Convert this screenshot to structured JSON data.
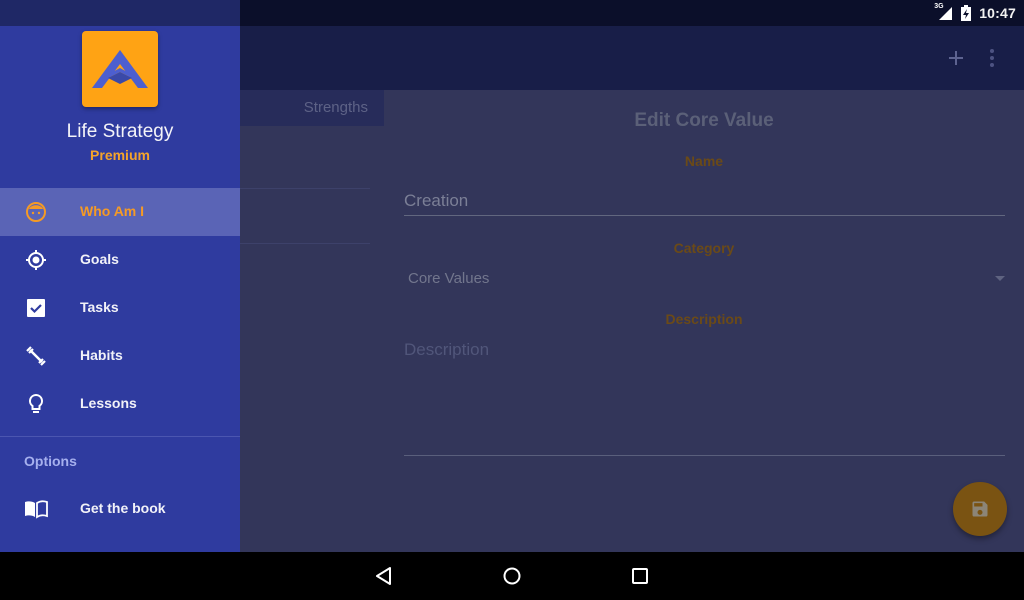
{
  "status_bar": {
    "time": "10:47",
    "network_label": "3G",
    "icons": [
      "signal-3g-icon",
      "battery-charging-icon"
    ]
  },
  "app_bar": {
    "actions": [
      {
        "name": "add",
        "icon": "plus-icon"
      },
      {
        "name": "more",
        "icon": "more-vertical-icon"
      }
    ]
  },
  "tabs": {
    "visible_tab": "Strengths"
  },
  "edit_form": {
    "title": "Edit Core Value",
    "name_label": "Name",
    "name_value": "Creation",
    "category_label": "Category",
    "category_value": "Core Values",
    "description_label": "Description",
    "description_placeholder": "Description",
    "save_icon": "save-icon"
  },
  "drawer": {
    "app_name": "Life Strategy",
    "tier": "Premium",
    "items": [
      {
        "label": "Who Am I",
        "icon": "face-icon",
        "active": true
      },
      {
        "label": "Goals",
        "icon": "target-icon",
        "active": false
      },
      {
        "label": "Tasks",
        "icon": "checkbox-icon",
        "active": false
      },
      {
        "label": "Habits",
        "icon": "dumbbell-icon",
        "active": false
      },
      {
        "label": "Lessons",
        "icon": "lightbulb-icon",
        "active": false
      }
    ],
    "section_header": "Options",
    "option_items": [
      {
        "label": "Get the book",
        "icon": "book-icon"
      }
    ]
  },
  "colors": {
    "drawer_bg": "#2f3b9f",
    "accent": "#f59a25",
    "active_item_bg": "#5a64b6",
    "scrim_bg": "#33365a"
  },
  "nav_bar": {
    "buttons": [
      "back",
      "home",
      "recents"
    ]
  }
}
